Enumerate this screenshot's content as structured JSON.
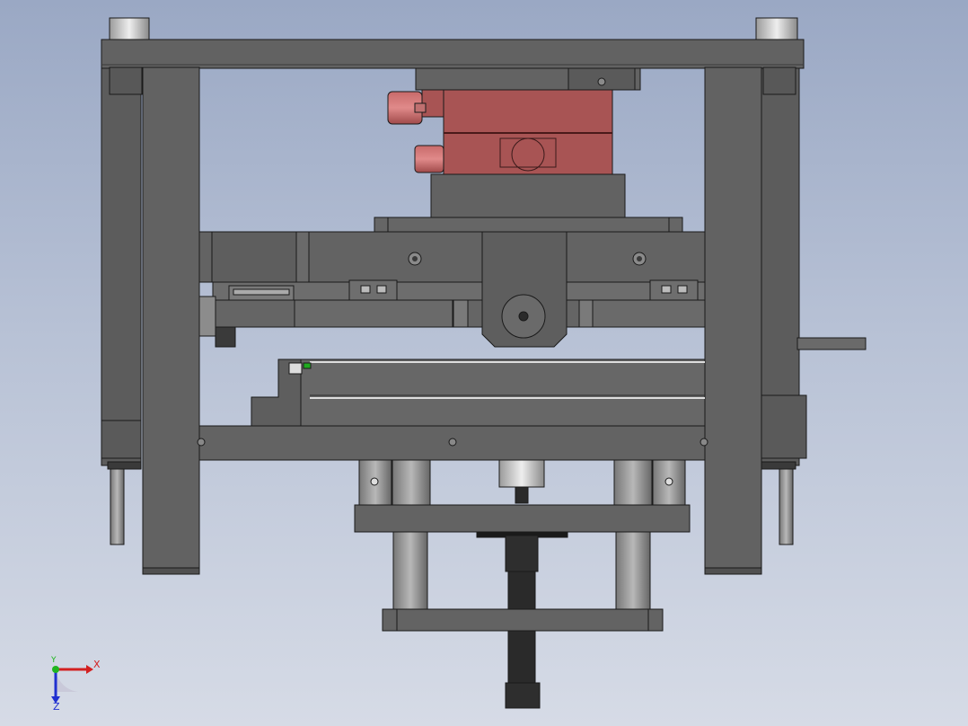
{
  "triad": {
    "x_label": "X",
    "y_label": "Y",
    "z_label": "Z",
    "x_color": "#d32020",
    "y_color": "#1fb51f",
    "z_color": "#2030d0"
  },
  "colors": {
    "steel": "#636363",
    "steel_dark": "#4e4e4e",
    "red_part": "#a85454",
    "edge": "#1a1a1a"
  }
}
